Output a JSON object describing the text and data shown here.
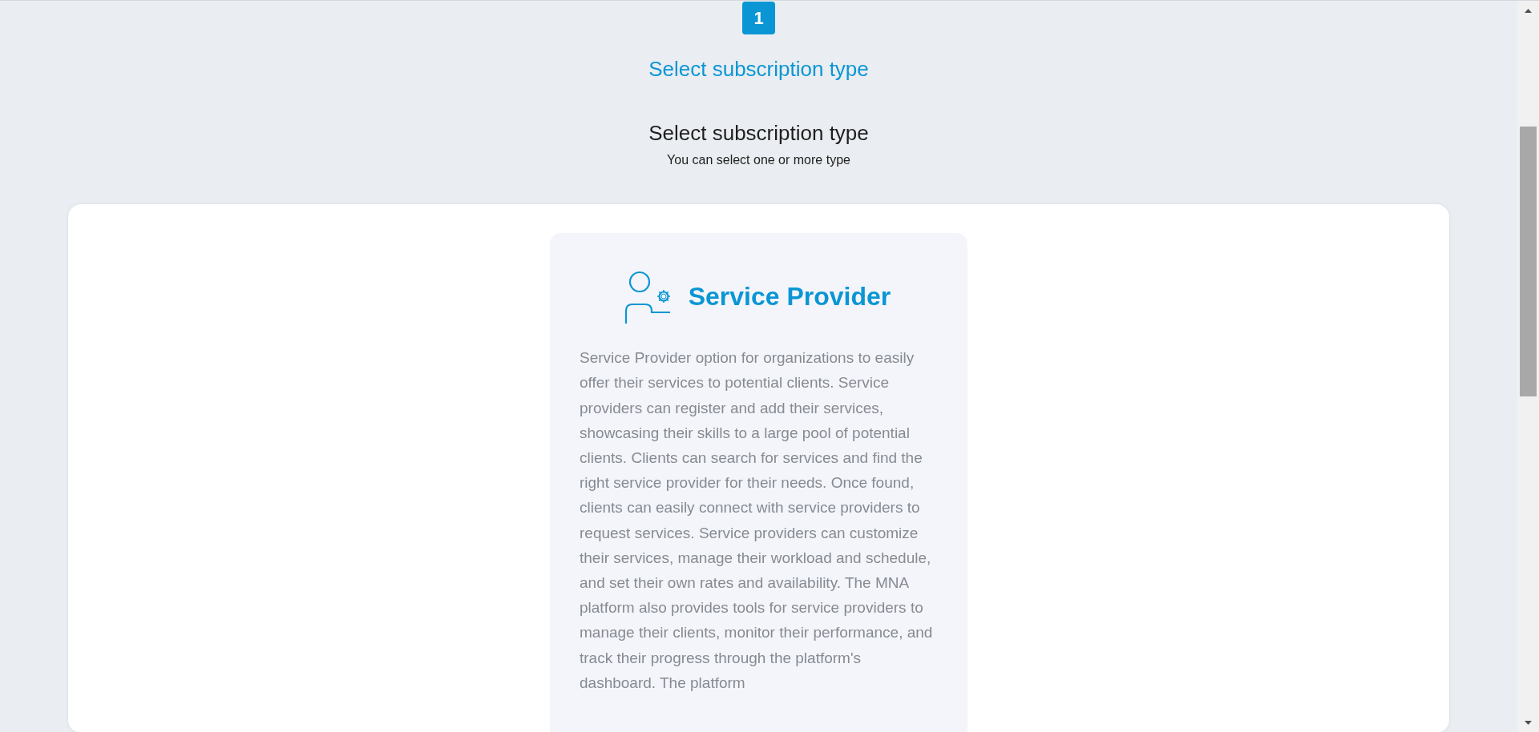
{
  "step": {
    "number": "1",
    "label": "Select subscription type"
  },
  "heading": {
    "title": "Select subscription type",
    "subtitle": "You can select one or more type"
  },
  "options": [
    {
      "kind": "service-provider",
      "title": "Service Provider",
      "description": "Service Provider option for organizations to easily offer their services to potential clients. Service providers can register and add their services, showcasing their skills to a large pool of potential clients. Clients can search for services and find the right service provider for their needs. Once found, clients can easily connect with service providers to request services. Service providers can customize their services, manage their workload and schedule, and set their own rates and availability. The MNA platform also provides tools for service providers to manage their clients, monitor their performance, and track their progress through the platform's dashboard. The platform"
    }
  ]
}
